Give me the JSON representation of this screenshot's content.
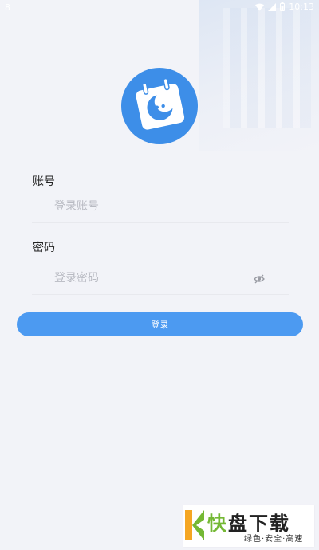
{
  "status_bar": {
    "left_indicator": "8",
    "time": "10:13",
    "icons": [
      "wifi-icon",
      "signal-icon",
      "battery-icon"
    ]
  },
  "app": {
    "logo_icon": "calendar-moon-logo-icon"
  },
  "login_form": {
    "account_label": "账号",
    "account_placeholder": "登录账号",
    "account_value": "",
    "password_label": "密码",
    "password_placeholder": "登录密码",
    "password_value": "",
    "password_toggle_icon": "eye-hidden-icon",
    "submit_label": "登录"
  },
  "watermark": {
    "brand_green": "快",
    "brand_dark": "盘下载",
    "tagline": "绿色·安全·高速"
  },
  "colors": {
    "accent": "#4c9af1",
    "logo_bg": "#3d8ee8",
    "background": "#f2f3f8",
    "watermark_green": "#74b834"
  }
}
